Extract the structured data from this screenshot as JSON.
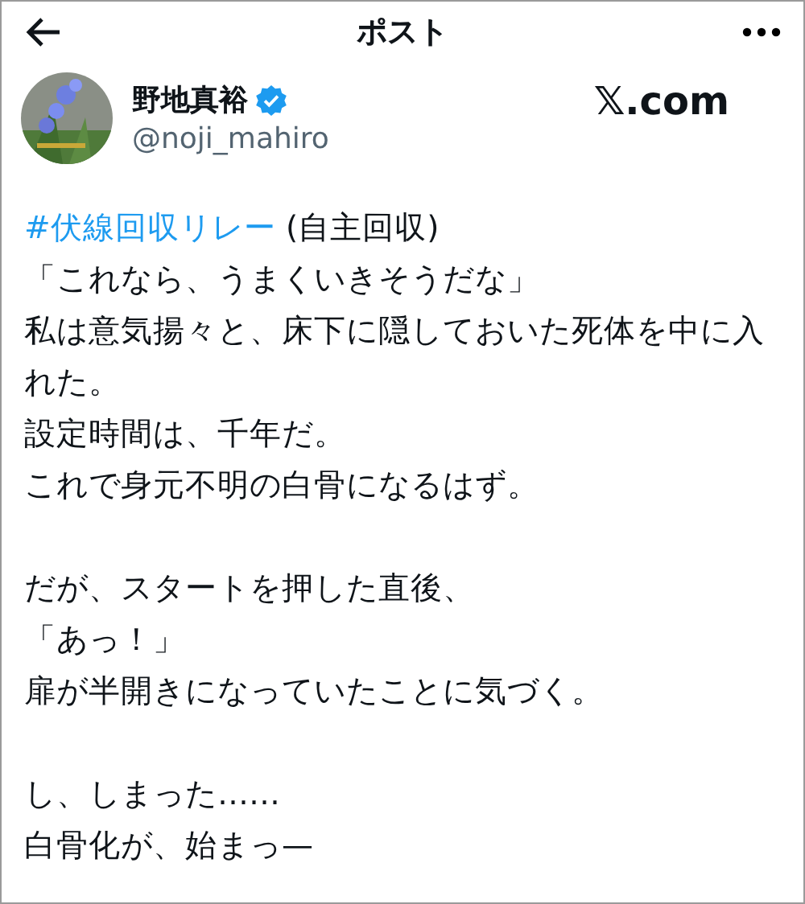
{
  "header": {
    "title": "ポスト"
  },
  "author": {
    "name": "野地真裕",
    "verified": true,
    "handle": "@noji_mahiro"
  },
  "source": "𝕏.com",
  "post": {
    "hashtag": "#伏線回収リレー",
    "tag_note": "(自主回収)",
    "paragraphs": [
      [
        "「これなら、うまくいきそうだな」",
        "私は意気揚々と、床下に隠しておいた死体を中に入れた。",
        "設定時間は、千年だ。",
        "これで身元不明の白骨になるはず。"
      ],
      [
        "だが、スタートを押した直後、",
        "「あっ！」",
        "扉が半開きになっていたことに気づく。"
      ],
      [
        "し、しまった……",
        "白骨化が、始まっ—"
      ]
    ]
  }
}
